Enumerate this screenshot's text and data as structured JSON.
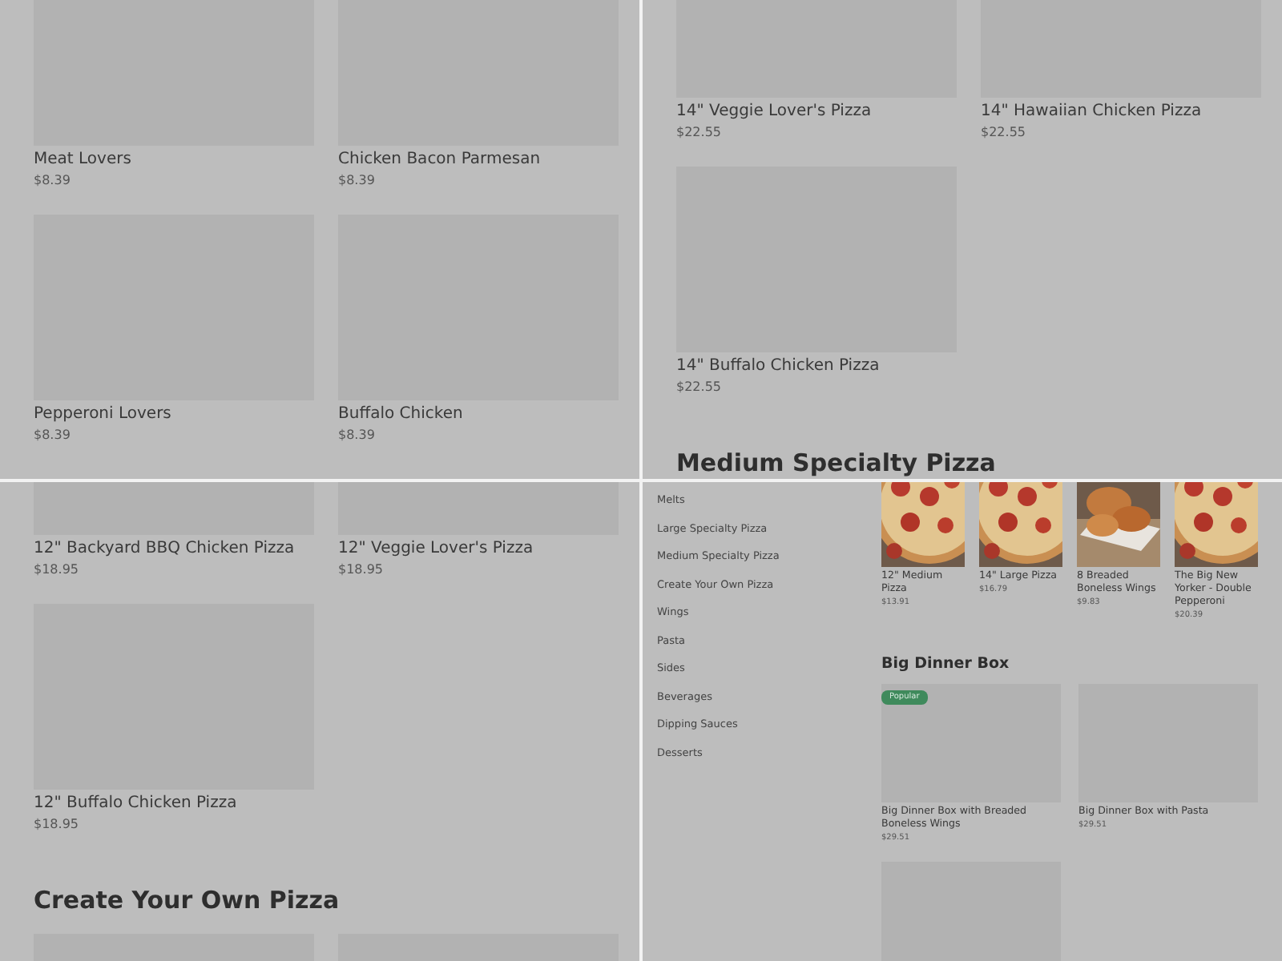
{
  "panels": [
    {
      "blocks": [
        {
          "kind": "cards",
          "items": [
            {
              "kind": "placeholder",
              "title": "Meat Lovers",
              "price": "$8.39"
            },
            {
              "kind": "placeholder",
              "title": "Chicken Bacon Parmesan",
              "price": "$8.39"
            },
            {
              "kind": "placeholder",
              "title": "Pepperoni Lovers",
              "price": "$8.39"
            },
            {
              "kind": "placeholder",
              "title": "Buffalo Chicken",
              "price": "$8.39"
            }
          ]
        }
      ]
    },
    {
      "blocks": [
        {
          "kind": "cards",
          "items": [
            {
              "kind": "placeholder",
              "title": "14\" Veggie Lover's Pizza",
              "price": "$22.55"
            },
            {
              "kind": "placeholder",
              "title": "14\" Hawaiian Chicken Pizza",
              "price": "$22.55"
            },
            {
              "kind": "placeholder",
              "title": "14\" Buffalo Chicken Pizza",
              "price": "$22.55"
            }
          ]
        },
        {
          "kind": "heading",
          "text": "Medium Specialty Pizza"
        }
      ]
    },
    {
      "blocks": [
        {
          "kind": "cards",
          "items": [
            {
              "kind": "placeholder",
              "title": "12\" Backyard BBQ Chicken Pizza",
              "price": "$18.95"
            },
            {
              "kind": "placeholder",
              "title": "12\" Veggie Lover's Pizza",
              "price": "$18.95"
            },
            {
              "kind": "placeholder",
              "title": "12\" Buffalo Chicken Pizza",
              "price": "$18.95"
            }
          ]
        },
        {
          "kind": "heading",
          "text": "Create Your Own Pizza"
        },
        {
          "kind": "cards",
          "items": [
            {
              "kind": "placeholder"
            },
            {
              "kind": "placeholder"
            }
          ]
        }
      ]
    },
    {
      "sidebar": [
        "Melts",
        "Large Specialty Pizza",
        "Medium Specialty Pizza",
        "Create Your Own Pizza",
        "Wings",
        "Pasta",
        "Sides",
        "Beverages",
        "Dipping Sauces",
        "Desserts"
      ],
      "blocks": [
        {
          "kind": "thumbs",
          "items": [
            {
              "kind": "picture",
              "title": "12\" Medium Pizza",
              "price": "$13.91"
            },
            {
              "kind": "picture",
              "title": "14\" Large Pizza",
              "price": "$16.79"
            },
            {
              "kind": "picture",
              "title": "8 Breaded Boneless Wings",
              "price": "$9.83"
            },
            {
              "kind": "picture",
              "title": "The Big New Yorker - Double Pepperoni",
              "price": "$20.39"
            }
          ]
        },
        {
          "kind": "heading",
          "text": "Big Dinner Box"
        },
        {
          "kind": "tiles",
          "items": [
            {
              "kind": "placeholder",
              "badge": "Popular",
              "title": "Big Dinner Box with Breaded Boneless Wings",
              "price": "$29.51"
            },
            {
              "kind": "placeholder",
              "title": "Big Dinner Box with Pasta",
              "price": "$29.51"
            },
            {
              "kind": "placeholder"
            }
          ]
        }
      ]
    }
  ]
}
